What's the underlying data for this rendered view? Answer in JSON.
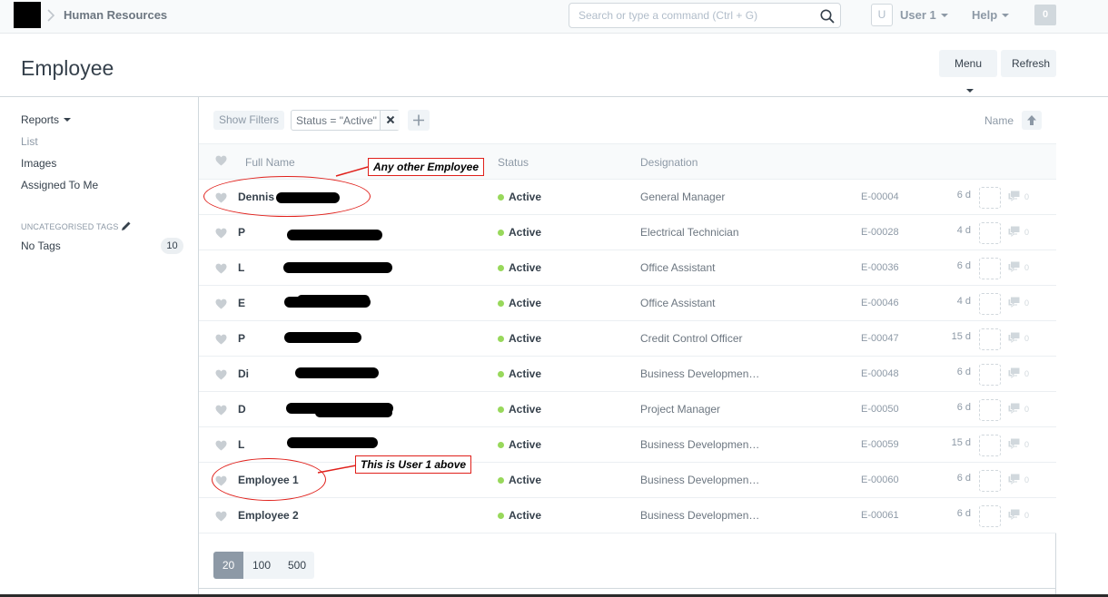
{
  "navbar": {
    "breadcrumb": "Human Resources",
    "search_placeholder": "Search or type a command (Ctrl + G)",
    "avatar_letter": "U",
    "user_label": "User 1",
    "help_label": "Help",
    "notification_count": "0"
  },
  "page": {
    "title": "Employee",
    "menu_label": "Menu",
    "refresh_label": "Refresh"
  },
  "sidebar": {
    "reports_label": "Reports",
    "links": [
      "List",
      "Images",
      "Assigned To Me"
    ],
    "tags_heading": "UNCATEGORISED TAGS",
    "no_tags_label": "No Tags",
    "no_tags_count": "10"
  },
  "filters": {
    "show_filters_label": "Show Filters",
    "active_filter": "Status = \"Active\"",
    "sort_label": "Name"
  },
  "columns": {
    "full_name": "Full Name",
    "status": "Status",
    "designation": "Designation"
  },
  "rows": [
    {
      "name": "Dennis",
      "status": "Active",
      "designation": "General Manager",
      "id": "E-00004",
      "modified": "6 d",
      "comments": "0"
    },
    {
      "name": "P",
      "status": "Active",
      "designation": "Electrical Technician",
      "id": "E-00028",
      "modified": "4 d",
      "comments": "0"
    },
    {
      "name": "L",
      "status": "Active",
      "designation": "Office Assistant",
      "id": "E-00036",
      "modified": "6 d",
      "comments": "0"
    },
    {
      "name": "E",
      "status": "Active",
      "designation": "Office Assistant",
      "id": "E-00046",
      "modified": "4 d",
      "comments": "0"
    },
    {
      "name": "P",
      "status": "Active",
      "designation": "Credit Control Officer",
      "id": "E-00047",
      "modified": "15 d",
      "comments": "0"
    },
    {
      "name": "Di",
      "status": "Active",
      "designation": "Business Developmen…",
      "id": "E-00048",
      "modified": "6 d",
      "comments": "0"
    },
    {
      "name": "D",
      "status": "Active",
      "designation": "Project Manager",
      "id": "E-00050",
      "modified": "6 d",
      "comments": "0"
    },
    {
      "name": "L",
      "status": "Active",
      "designation": "Business Developmen…",
      "id": "E-00059",
      "modified": "15 d",
      "comments": "0"
    },
    {
      "name": "Employee 1",
      "status": "Active",
      "designation": "Business Developmen…",
      "id": "E-00060",
      "modified": "6 d",
      "comments": "0"
    },
    {
      "name": "Employee 2",
      "status": "Active",
      "designation": "Business Developmen…",
      "id": "E-00061",
      "modified": "6 d",
      "comments": "0"
    }
  ],
  "paging": [
    "20",
    "100",
    "500"
  ],
  "annotations": {
    "other_employee": "Any other Employee",
    "user_one": "This is User 1 above"
  },
  "colors": {
    "active_dot": "#98d85b",
    "annotation_red": "#e0201b",
    "page_active": "#8d99a6"
  }
}
